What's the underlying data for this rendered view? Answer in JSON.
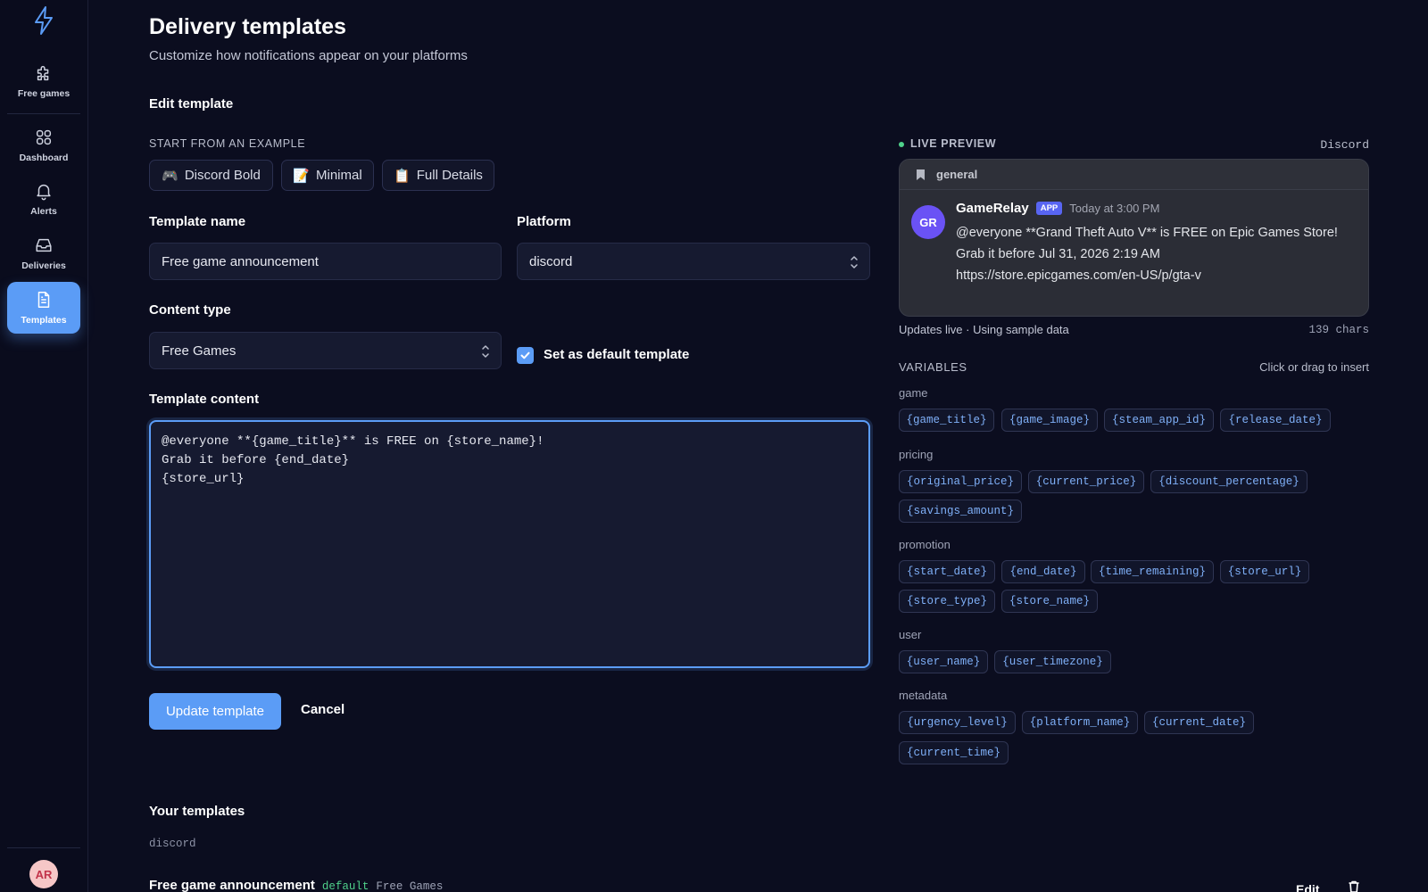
{
  "sidebar": {
    "items": [
      {
        "label": "Free games",
        "icon": "puzzle-icon",
        "active": false
      },
      {
        "label": "Dashboard",
        "icon": "grid-icon",
        "active": false
      },
      {
        "label": "Alerts",
        "icon": "bell-icon",
        "active": false
      },
      {
        "label": "Deliveries",
        "icon": "inbox-icon",
        "active": false
      },
      {
        "label": "Templates",
        "icon": "file-text-icon",
        "active": true
      }
    ],
    "avatar_initials": "AR"
  },
  "header": {
    "title": "Delivery templates",
    "subtitle": "Customize how notifications appear on your platforms"
  },
  "editor": {
    "section_title": "Edit template",
    "examples_label": "START FROM AN EXAMPLE",
    "examples": [
      {
        "emoji": "🎮",
        "label": "Discord Bold"
      },
      {
        "emoji": "📝",
        "label": "Minimal"
      },
      {
        "emoji": "📋",
        "label": "Full Details"
      }
    ],
    "name_label": "Template name",
    "name_value": "Free game announcement",
    "platform_label": "Platform",
    "platform_value": "discord",
    "content_type_label": "Content type",
    "content_type_value": "Free Games",
    "default_label": "Set as default template",
    "default_checked": true,
    "content_label": "Template content",
    "content_value": "@everyone **{game_title}** is FREE on {store_name}!\nGrab it before {end_date}\n{store_url}",
    "update_label": "Update template",
    "cancel_label": "Cancel"
  },
  "templates_list": {
    "title": "Your templates",
    "group": "discord",
    "items": [
      {
        "name": "Free game announcement",
        "badge": "default",
        "type": "Free Games",
        "edit_label": "Edit"
      }
    ]
  },
  "preview": {
    "label": "LIVE PREVIEW",
    "platform": "Discord",
    "channel": "general",
    "bot_initials": "GR",
    "bot_name": "GameRelay",
    "app_badge": "APP",
    "time": "Today at 3:00 PM",
    "message": "@everyone **Grand Theft Auto V** is FREE on Epic Games Store!\nGrab it before Jul 31, 2026 2:19 AM\nhttps://store.epicgames.com/en-US/p/gta-v",
    "footer": "Updates live · Using sample data",
    "char_count": "139 chars"
  },
  "variables": {
    "title": "VARIABLES",
    "hint": "Click or drag to insert",
    "categories": [
      {
        "name": "game",
        "chips": [
          "{game_title}",
          "{game_image}",
          "{steam_app_id}",
          "{release_date}"
        ]
      },
      {
        "name": "pricing",
        "chips": [
          "{original_price}",
          "{current_price}",
          "{discount_percentage}",
          "{savings_amount}"
        ]
      },
      {
        "name": "promotion",
        "chips": [
          "{start_date}",
          "{end_date}",
          "{time_remaining}",
          "{store_url}",
          "{store_type}",
          "{store_name}"
        ]
      },
      {
        "name": "user",
        "chips": [
          "{user_name}",
          "{user_timezone}"
        ]
      },
      {
        "name": "metadata",
        "chips": [
          "{urgency_level}",
          "{platform_name}",
          "{current_date}",
          "{current_time}"
        ]
      }
    ]
  },
  "colors": {
    "background": "#0b0d1f",
    "accent": "#5b9cf6",
    "success": "#4fd18b",
    "discord_card": "#2b2d36",
    "chip_text": "#7fb0f8"
  }
}
